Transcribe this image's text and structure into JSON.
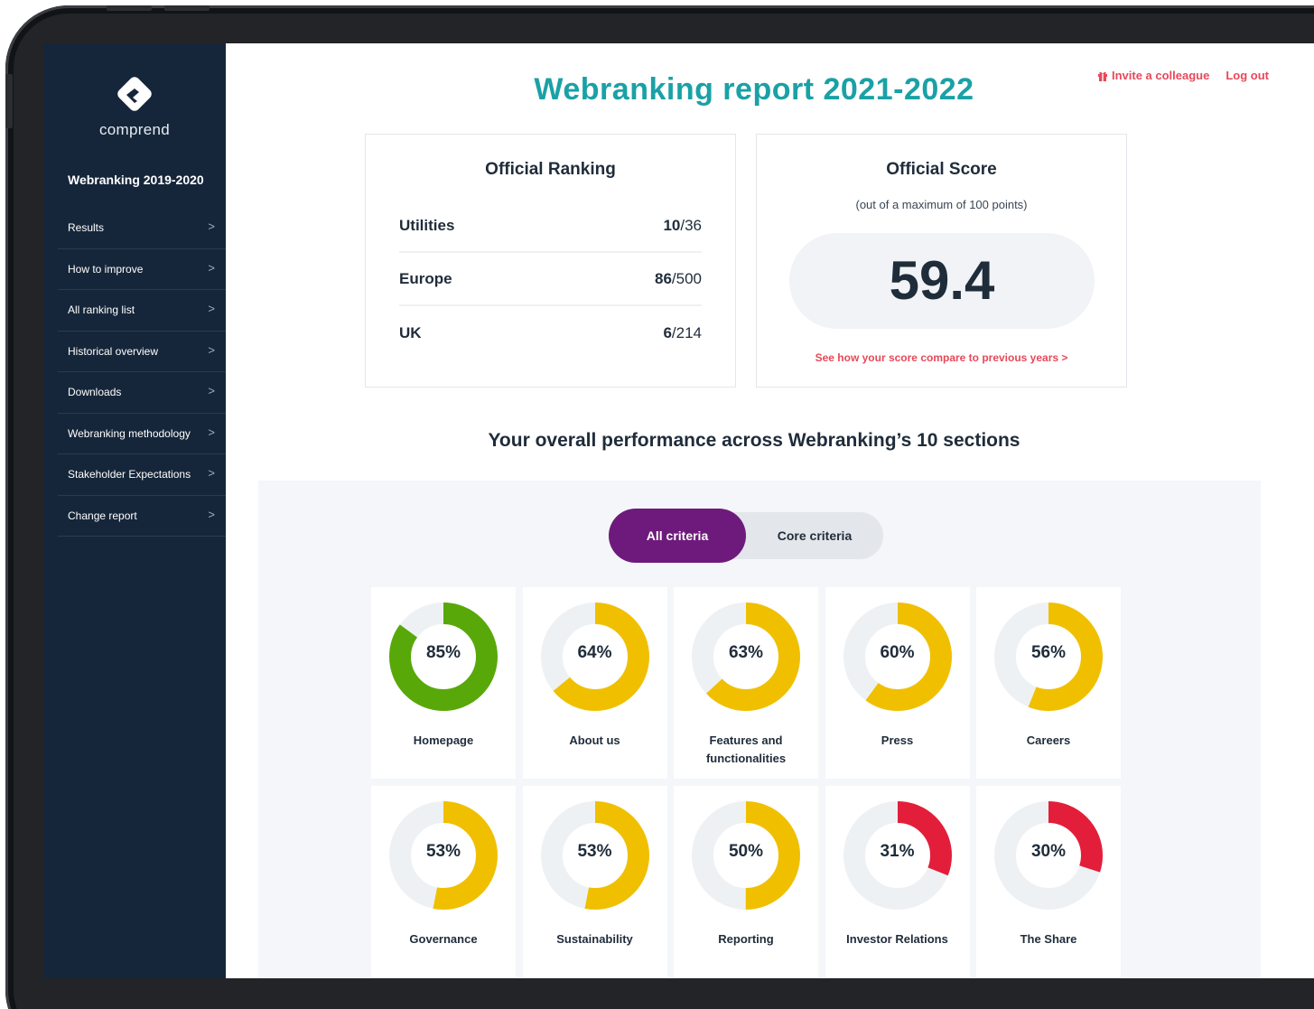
{
  "app": {
    "brand": "comprend",
    "sidebar_title": "Webranking 2019-2020",
    "nav_items": [
      {
        "label": "Results"
      },
      {
        "label": "How to improve"
      },
      {
        "label": "All ranking list"
      },
      {
        "label": "Historical overview"
      },
      {
        "label": "Downloads"
      },
      {
        "label": "Webranking methodology"
      },
      {
        "label": "Stakeholder Expectations"
      },
      {
        "label": "Change report"
      }
    ],
    "chevron": ">"
  },
  "header": {
    "title": "Webranking report 2021-2022",
    "invite_label": "Invite a colleague",
    "logout_label": "Log out"
  },
  "ranking": {
    "title": "Official Ranking",
    "rows": [
      {
        "name": "Utilities",
        "rank": "10",
        "total": "/36"
      },
      {
        "name": "Europe",
        "rank": "86",
        "total": "/500"
      },
      {
        "name": "UK",
        "rank": "6",
        "total": "/214"
      }
    ]
  },
  "score": {
    "title": "Official Score",
    "subtitle": "(out of a maximum of 100 points)",
    "value": "59.4",
    "link": "See how your score compare to previous years >"
  },
  "performance": {
    "heading": "Your overall performance across Webranking’s 10 sections",
    "toggle_all": "All criteria",
    "toggle_core": "Core criteria",
    "colors": {
      "good": "#58a80a",
      "mid": "#f0c000",
      "low": "#e31e3a",
      "track": "#eef1f4"
    },
    "sections": [
      {
        "label": "Homepage",
        "value": 85,
        "pct": "85%",
        "color": "#58a80a"
      },
      {
        "label": "About us",
        "value": 64,
        "pct": "64%",
        "color": "#f0c000"
      },
      {
        "label": "Features and functionalities",
        "value": 63,
        "pct": "63%",
        "color": "#f0c000"
      },
      {
        "label": "Press",
        "value": 60,
        "pct": "60%",
        "color": "#f0c000"
      },
      {
        "label": "Careers",
        "value": 56,
        "pct": "56%",
        "color": "#f0c000"
      },
      {
        "label": "Governance",
        "value": 53,
        "pct": "53%",
        "color": "#f0c000"
      },
      {
        "label": "Sustainability",
        "value": 53,
        "pct": "53%",
        "color": "#f0c000"
      },
      {
        "label": "Reporting",
        "value": 50,
        "pct": "50%",
        "color": "#f0c000"
      },
      {
        "label": "Investor Relations",
        "value": 31,
        "pct": "31%",
        "color": "#e31e3a"
      },
      {
        "label": "The Share",
        "value": 30,
        "pct": "30%",
        "color": "#e31e3a"
      }
    ]
  }
}
